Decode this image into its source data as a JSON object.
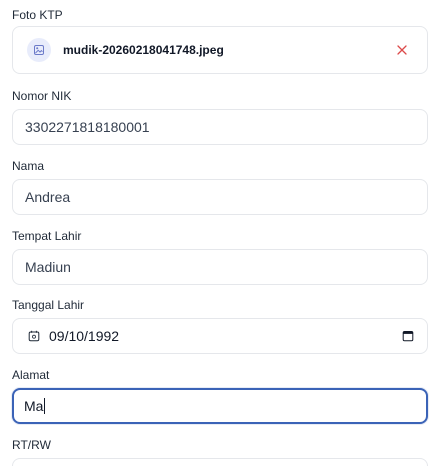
{
  "photo": {
    "label": "Foto KTP",
    "file_name": "mudik-20260218041748.jpeg"
  },
  "nik": {
    "label": "Nomor NIK",
    "value": "3302271818180001"
  },
  "name": {
    "label": "Nama",
    "value": "Andrea"
  },
  "birthplace": {
    "label": "Tempat Lahir",
    "value": "Madiun"
  },
  "birthdate": {
    "label": "Tanggal Lahir",
    "value": "09/10/1992"
  },
  "address": {
    "label": "Alamat",
    "value": "Ma"
  },
  "rtrw": {
    "label": "RT/RW"
  },
  "colors": {
    "focus_border": "#3b63b7",
    "remove_icon": "#dc4a4a",
    "file_icon_bg": "#e8ecfb"
  }
}
